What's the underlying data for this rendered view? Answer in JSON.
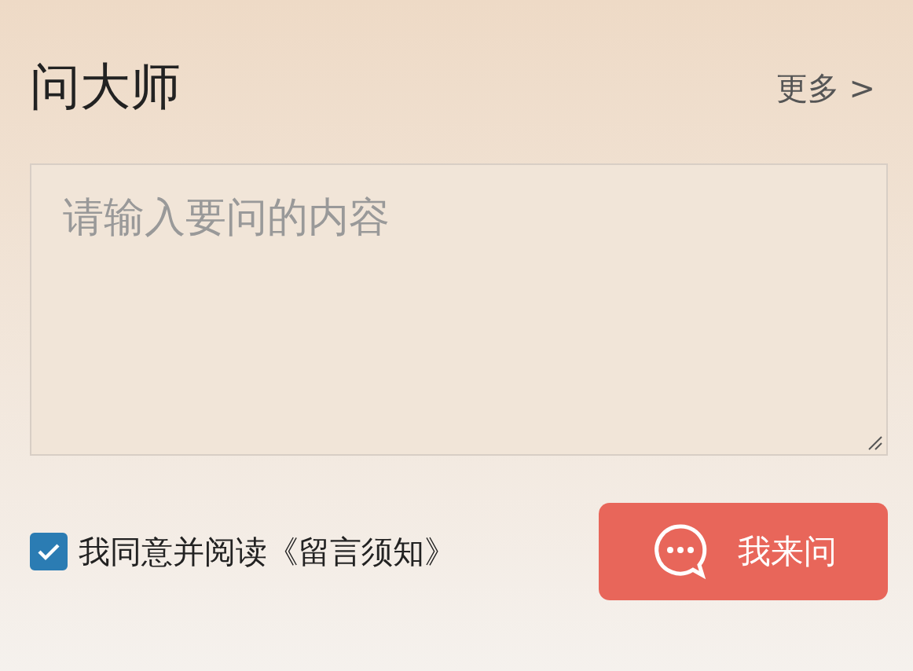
{
  "header": {
    "title": "问大师",
    "more_link": "更多 >"
  },
  "question": {
    "placeholder": "请输入要问的内容"
  },
  "agreement": {
    "checked": true,
    "label": "我同意并阅读《留言须知》"
  },
  "submit": {
    "label": "我来问"
  }
}
